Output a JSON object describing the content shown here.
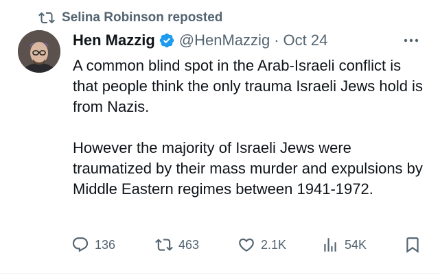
{
  "repost": {
    "icon": "repost-icon",
    "text": "Selina Robinson reposted"
  },
  "author": {
    "name": "Hen Mazzig",
    "verified_icon": "verified-badge-icon",
    "verified_color": "#1d9bf0",
    "handle": "@HenMazzig",
    "separator": "·",
    "date": "Oct 24",
    "avatar": "avatar"
  },
  "more_icon": "more-options-icon",
  "tweet": {
    "paragraphs": [
      "A common blind spot in the Arab-Israeli conflict is that people think the only trauma Israeli Jews hold is from Nazis.",
      "However the majority of Israeli Jews were traumatized by their mass murder and expulsions by Middle Eastern regimes between 1941-1972."
    ]
  },
  "actions": {
    "reply": {
      "icon": "reply-icon",
      "count": "136"
    },
    "repost": {
      "icon": "repost-icon",
      "count": "463"
    },
    "like": {
      "icon": "like-icon",
      "count": "2.1K"
    },
    "views": {
      "icon": "views-icon",
      "count": "54K"
    },
    "bookmark": {
      "icon": "bookmark-icon"
    }
  },
  "colors": {
    "text": "#0f1419",
    "secondary": "#536471",
    "accent": "#1d9bf0"
  }
}
